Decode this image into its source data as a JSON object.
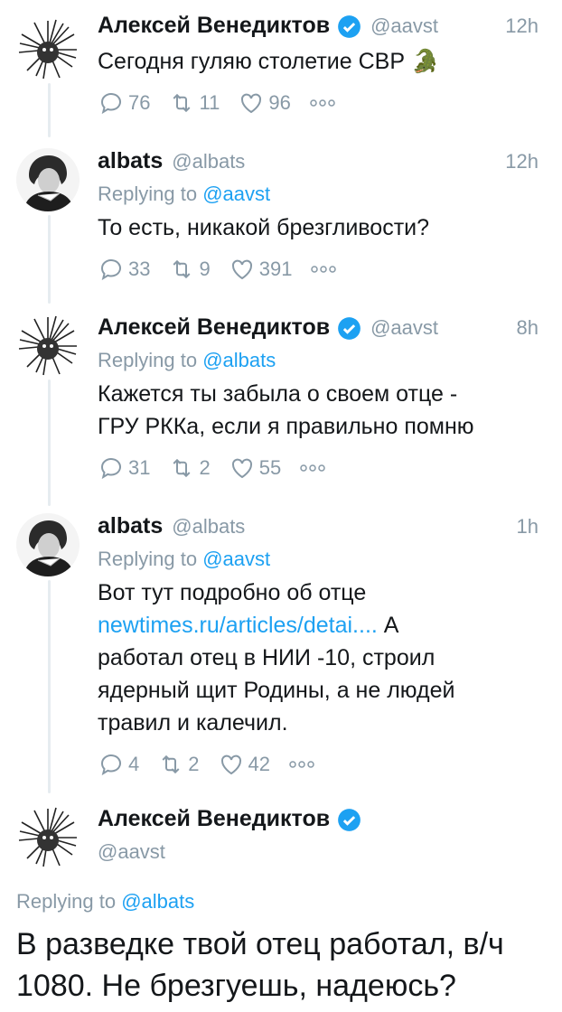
{
  "tweets": [
    {
      "name": "Алексей Венедиктов",
      "handle": "@aavst",
      "time": "12h",
      "reply_prefix": "",
      "reply_mention": "",
      "text": "Сегодня гуляю столетие СВР 🐊",
      "replies": "76",
      "retweets": "11",
      "likes": "96"
    },
    {
      "name": "albats",
      "handle": "@albats",
      "time": "12h",
      "reply_prefix": "Replying to ",
      "reply_mention": "@aavst",
      "text": "То есть, никакой брезгливости?",
      "replies": "33",
      "retweets": "9",
      "likes": "391"
    },
    {
      "name": "Алексей Венедиктов",
      "handle": "@aavst",
      "time": "8h",
      "reply_prefix": "Replying to ",
      "reply_mention": "@albats",
      "text_lines": [
        "Кажется ты забыла о своем отце -",
        "ГРУ РККа, если я правильно помню"
      ],
      "replies": "31",
      "retweets": "2",
      "likes": "55"
    },
    {
      "name": "albats",
      "handle": "@albats",
      "time": "1h",
      "reply_prefix": "Replying to ",
      "reply_mention": "@aavst",
      "text_line1": "Вот тут подробно об отце",
      "link": "newtimes.ru/articles/detai....",
      "text_after_link": " А",
      "text_rest": [
        "работал отец в НИИ -10, строил",
        "ядерный щит Родины, а не людей",
        "травил и калечил."
      ],
      "replies": "4",
      "retweets": "2",
      "likes": "42"
    }
  ],
  "main_tweet": {
    "name": "Алексей Венедиктов",
    "handle": "@aavst",
    "reply_prefix": "Replying to ",
    "reply_mention": "@albats",
    "text_lines": [
      "В разведке твой отец работал, в/ч",
      "1080. Не брезгуешь, надеюсь?"
    ]
  },
  "colors": {
    "accent": "#1da1f2",
    "secondary_text": "#8899a6",
    "thread_line": "#e6ecf0"
  },
  "icons": [
    "reply-icon",
    "retweet-icon",
    "like-icon",
    "more-icon",
    "verified-badge-icon"
  ]
}
